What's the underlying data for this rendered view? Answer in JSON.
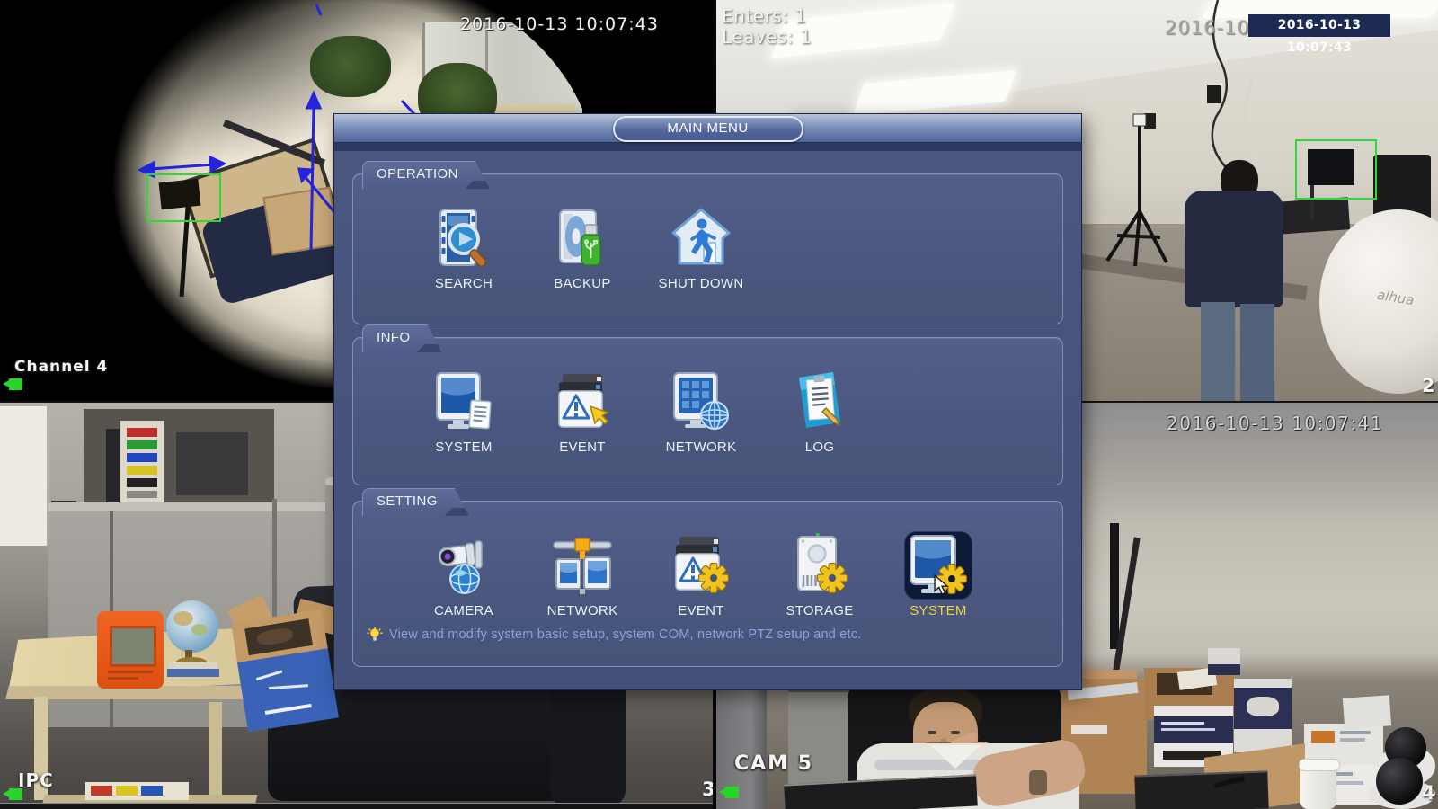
{
  "main_menu": {
    "title": "MAIN MENU",
    "sections": [
      {
        "label": "OPERATION",
        "items": [
          {
            "label": "SEARCH"
          },
          {
            "label": "BACKUP"
          },
          {
            "label": "SHUT DOWN"
          }
        ]
      },
      {
        "label": "INFO",
        "items": [
          {
            "label": "SYSTEM"
          },
          {
            "label": "EVENT"
          },
          {
            "label": "NETWORK"
          },
          {
            "label": "LOG"
          }
        ]
      },
      {
        "label": "SETTING",
        "items": [
          {
            "label": "CAMERA"
          },
          {
            "label": "NETWORK"
          },
          {
            "label": "EVENT"
          },
          {
            "label": "STORAGE"
          },
          {
            "label": "SYSTEM",
            "selected": true
          }
        ]
      }
    ],
    "selected_item": "SYSTEM",
    "hint": "View and modify system basic setup, system COM, network PTZ setup and etc."
  },
  "cameras": {
    "top_left": {
      "timestamp": "2016-10-13 10:07:43",
      "channel_label": "Channel 4",
      "recording": true
    },
    "top_right": {
      "enters_label": "Enters: 1",
      "leaves_label": "Leaves: 1",
      "camera_osd_partial": "2016-10",
      "overlay_timestamp": "2016-10-13 10:07:43",
      "channel_number": "2",
      "dome_logo": "alhua"
    },
    "bottom_left": {
      "channel_label": "IPC",
      "channel_number": "3",
      "recording": true
    },
    "bottom_right": {
      "channel_label": "CAM 5",
      "timestamp": "2016-10-13 10:07:41",
      "channel_number": "4",
      "recording": true
    }
  },
  "colors": {
    "menu_body": "#46537b",
    "panel_border": "#8090b6",
    "selected_label": "#ecd23c",
    "hint_text": "#8da0dc",
    "detection_green": "#2fd934",
    "record_green": "#27d427",
    "overlay_timestamp_box": "#1d2a52"
  }
}
